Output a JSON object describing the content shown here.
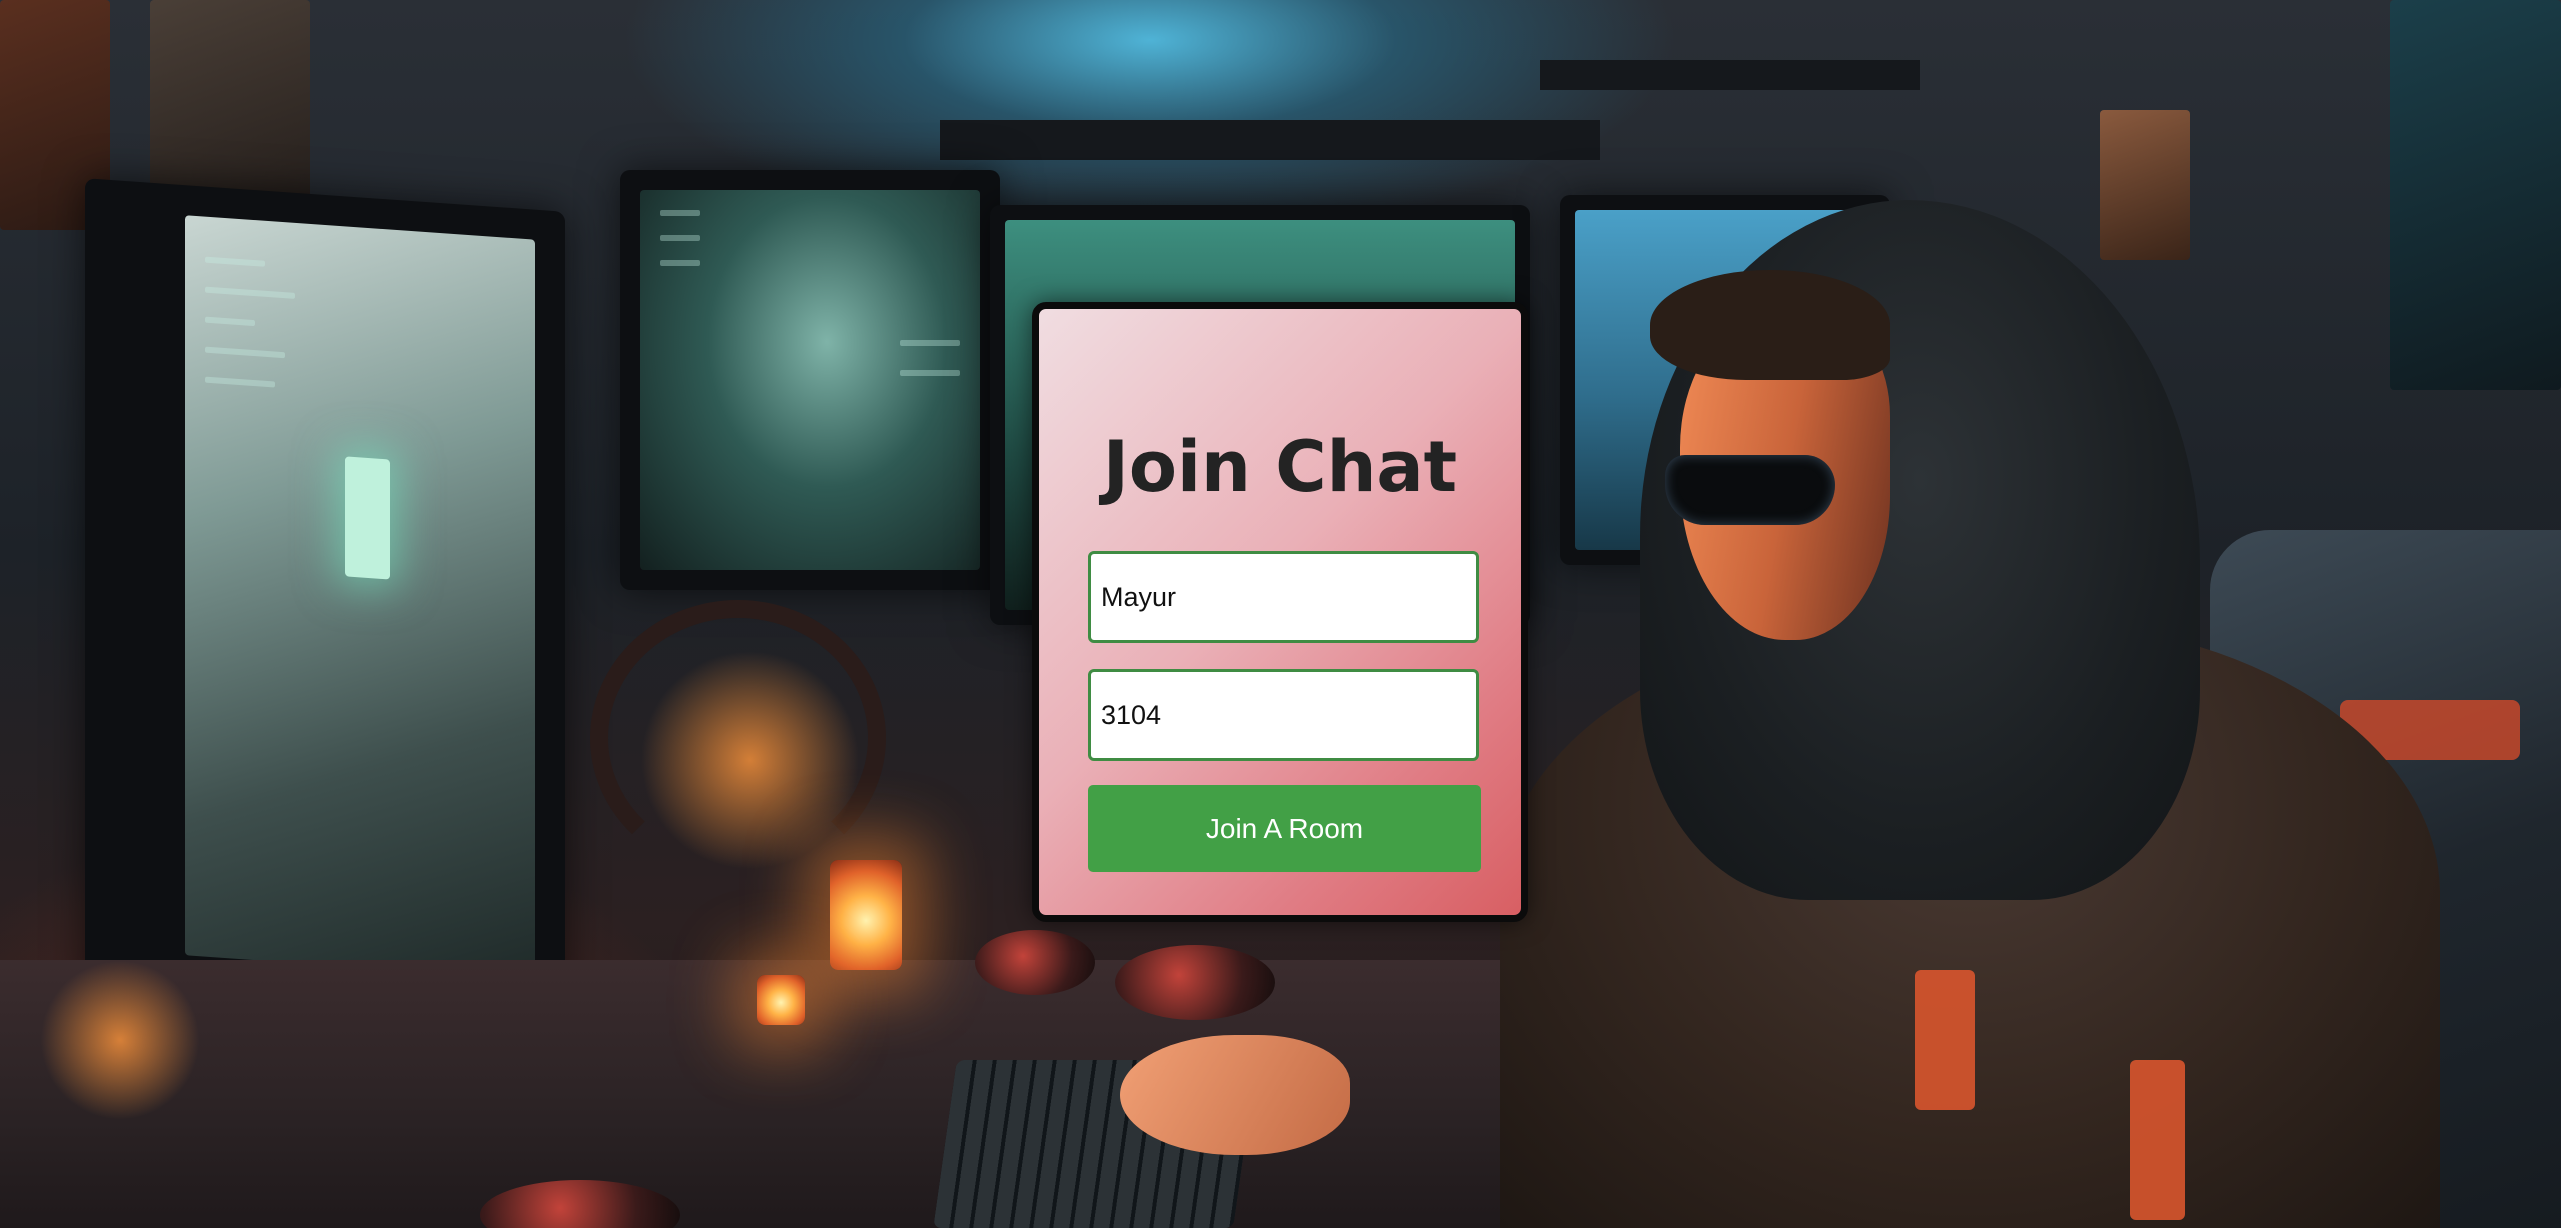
{
  "join_form": {
    "title": "Join Chat",
    "name_input": {
      "value": "Mayur"
    },
    "room_input": {
      "value": "3104"
    },
    "submit_label": "Join A Room"
  },
  "theme": {
    "card_border": "#0b0b0b",
    "card_gradient_start": "#f0dde1",
    "card_gradient_end": "#d85f63",
    "input_border": "#3f8c43",
    "button_bg": "#42a046",
    "button_text": "#ffffff",
    "title_color": "#232323"
  },
  "background": {
    "image": "hooded-gamer-desk-illustration"
  }
}
